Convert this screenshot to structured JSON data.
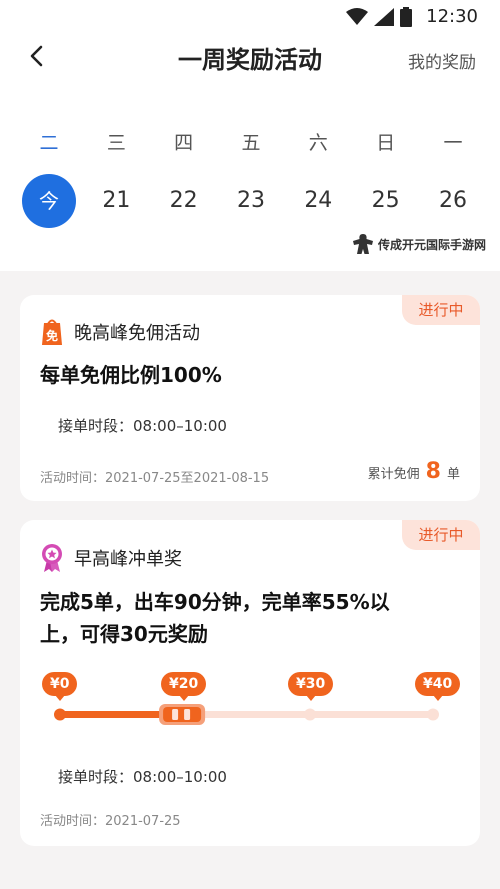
{
  "status_bar": {
    "time": "12:30"
  },
  "header": {
    "title": "一周奖励活动",
    "my_rewards": "我的奖励"
  },
  "week": {
    "days": [
      "二",
      "三",
      "四",
      "五",
      "六",
      "日",
      "一"
    ],
    "dates": [
      "今",
      "21",
      "22",
      "23",
      "24",
      "25",
      "26"
    ]
  },
  "watermark": {
    "text": "传成开元国际手游网"
  },
  "cards": [
    {
      "status": "进行中",
      "label": "晚高峰免佣活动",
      "icon_text": "免",
      "headline": "每单免佣比例100%",
      "period_label": "接单时段：",
      "period_value": "08:00–10:00",
      "activity_time": "活动时间：2021-07-25至2021-08-15",
      "cumulative_prefix": "累计免佣",
      "cumulative_count": "8",
      "cumulative_unit": "单"
    },
    {
      "status": "进行中",
      "label": "早高峰冲单奖",
      "headline_line1": "完成5单，出车90分钟，完单率55%以",
      "headline_line2": "上，可得30元奖励",
      "tiers": [
        "¥0",
        "¥20",
        "¥30",
        "¥40"
      ],
      "progress_fraction": 0.33,
      "period_label": "接单时段：",
      "period_value": "08:00–10:00",
      "activity_time": "活动时间：2021-07-25"
    }
  ],
  "colors": {
    "accent": "#f0641e",
    "blue": "#1f6fe0",
    "badge_bg": "#fde3da"
  }
}
